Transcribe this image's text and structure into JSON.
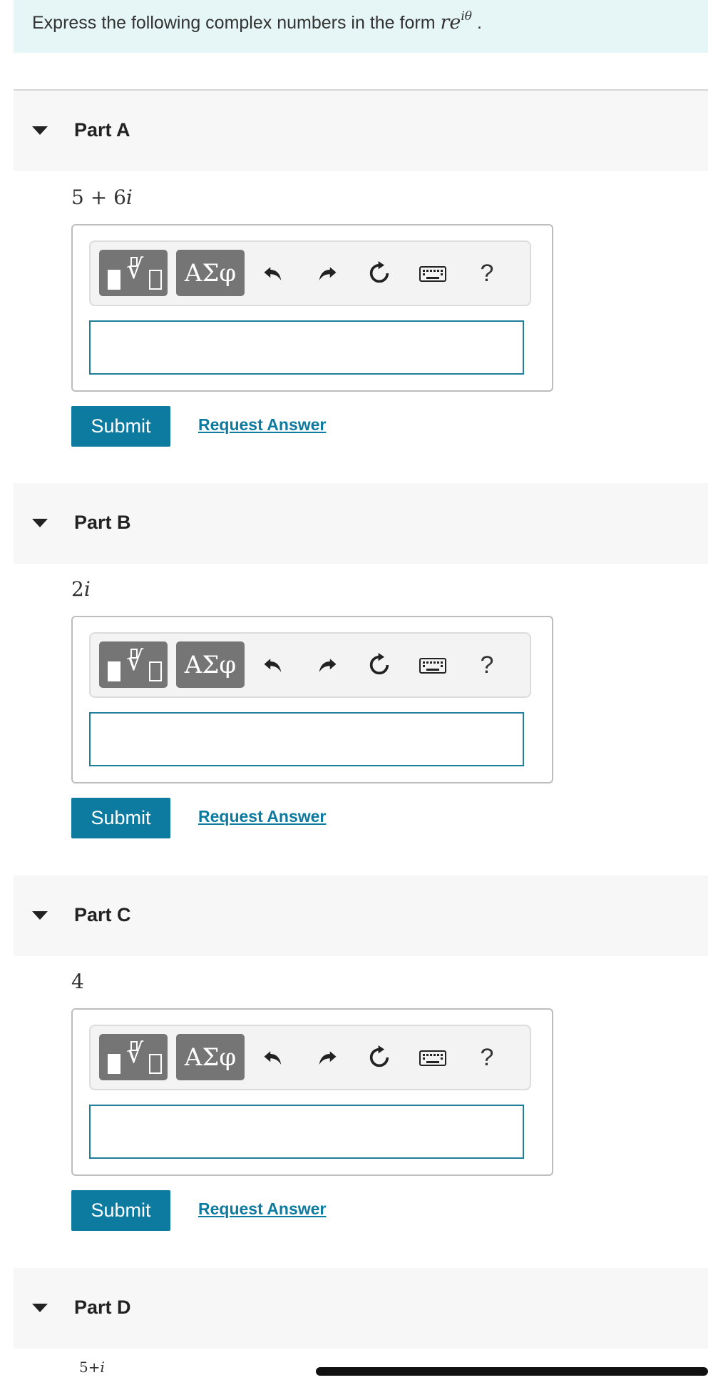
{
  "instructions": {
    "prefix": "Express the following complex numbers in the form ",
    "form_base": "re",
    "form_exponent": "iθ",
    "suffix": "."
  },
  "toolbar": {
    "greek_label": "ΑΣφ",
    "help_label": "?",
    "icons": [
      "templates-icon",
      "greek-letters-icon",
      "undo-icon",
      "redo-icon",
      "reset-icon",
      "keyboard-icon",
      "help-icon"
    ]
  },
  "actions": {
    "submit_label": "Submit",
    "request_answer_label": "Request Answer"
  },
  "parts": [
    {
      "title": "Part A",
      "expr_num": "5 + 6",
      "expr_var": "i",
      "answer": ""
    },
    {
      "title": "Part B",
      "expr_num": "2",
      "expr_var": "i",
      "answer": ""
    },
    {
      "title": "Part C",
      "expr_num": "4",
      "expr_var": "",
      "answer": ""
    },
    {
      "title": "Part D",
      "expr_num": "5+",
      "expr_var": "i",
      "answer": ""
    }
  ],
  "colors": {
    "accent": "#0d7aa0",
    "instructions_bg": "#e6f5f5",
    "toolbar_button": "#757575",
    "part_header_bg": "#f7f7f7"
  }
}
